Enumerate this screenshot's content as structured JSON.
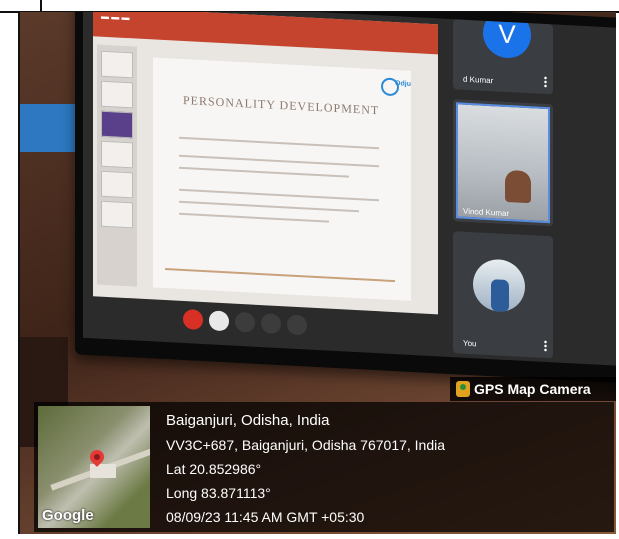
{
  "meeting": {
    "slide_title": "PERSONALITY DEVELOPMENT",
    "slide_logo": "Odju",
    "participants": [
      {
        "name": "d Kumar",
        "avatar_letter": "V"
      },
      {
        "name": "Vinod Kumar"
      },
      {
        "name": "You"
      }
    ]
  },
  "gps_overlay": {
    "brand": "GPS Map Camera",
    "place": "Baiganjuri, Odisha, India",
    "address": "VV3C+687, Baiganjuri, Odisha 767017, India",
    "lat": "Lat 20.852986°",
    "long": "Long 83.871113°",
    "datetime": "08/09/23 11:45 AM GMT +05:30",
    "map_logo": "Google"
  },
  "colors": {
    "end_call": "#d93025",
    "avatar": "#1a73e8",
    "ribbon": "#c4442d"
  }
}
